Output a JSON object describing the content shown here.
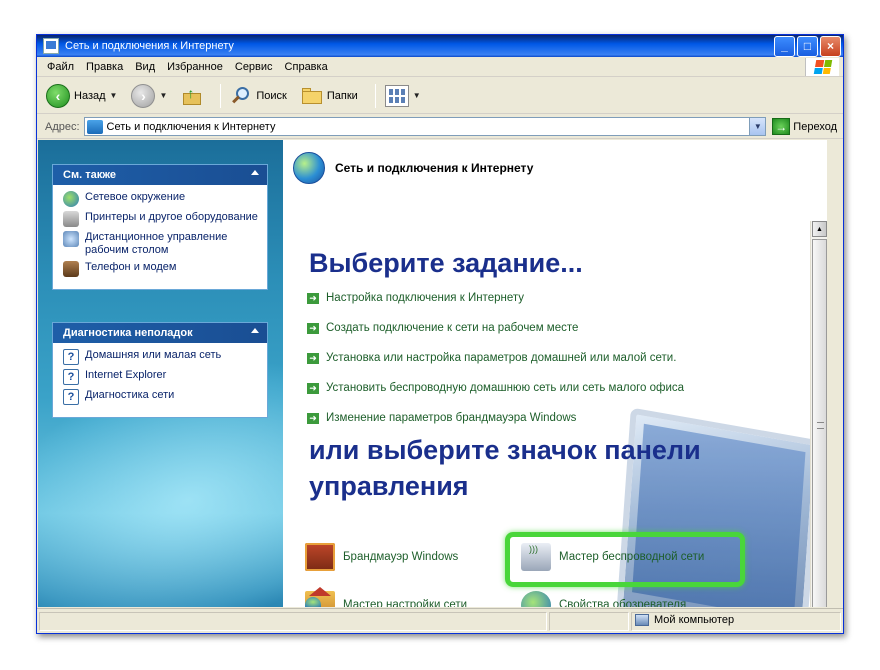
{
  "window": {
    "title": "Сеть и подключения к Интернету",
    "controls": {
      "minimize": "_",
      "maximize": "□",
      "close": "×"
    }
  },
  "menu": [
    "Файл",
    "Правка",
    "Вид",
    "Избранное",
    "Сервис",
    "Справка"
  ],
  "toolbar": {
    "back": "Назад",
    "search": "Поиск",
    "folders": "Папки"
  },
  "address": {
    "label": "Адрес:",
    "value": "Сеть и подключения к Интернету",
    "go": "Переход"
  },
  "see_also": {
    "title": "См. также",
    "items": [
      {
        "label": "Сетевое окружение",
        "icon": "network-neighborhood-icon"
      },
      {
        "label": "Принтеры и другое оборудование",
        "icon": "printer-icon"
      },
      {
        "label": "Дистанционное управление рабочим столом",
        "icon": "remote-desktop-icon"
      },
      {
        "label": "Телефон и модем",
        "icon": "phone-modem-icon"
      }
    ]
  },
  "troubleshooting": {
    "title": "Диагностика неполадок",
    "items": [
      {
        "label": "Домашняя или малая сеть",
        "icon": "help-icon"
      },
      {
        "label": "Internet Explorer",
        "icon": "help-icon"
      },
      {
        "label": "Диагностика сети",
        "icon": "help-icon"
      }
    ]
  },
  "main": {
    "header": "Сеть и подключения к Интернету",
    "pick_task": "Выберите задание...",
    "tasks": [
      "Настройка подключения к Интернету",
      "Создать подключение к сети на рабочем месте",
      "Установка или настройка параметров домашней или малой сети.",
      "Установить беспроводную домашнюю сеть или сеть малого офиса",
      "Изменение параметров брандмауэра Windows"
    ],
    "pick_icon": "или выберите значок панели управления",
    "icons": [
      {
        "label": "Брандмауэр Windows",
        "icon": "firewall-icon"
      },
      {
        "label": "Мастер беспроводной сети",
        "icon": "wireless-wizard-icon"
      },
      {
        "label": "Мастер настройки сети",
        "icon": "network-setup-icon"
      },
      {
        "label": "Свойства обозревателя",
        "icon": "internet-options-icon"
      }
    ]
  },
  "status": {
    "zone": "Мой компьютер"
  },
  "colors": {
    "highlight": "#49d63a",
    "heading": "#1a2f8c",
    "link": "#1d5e2a"
  }
}
